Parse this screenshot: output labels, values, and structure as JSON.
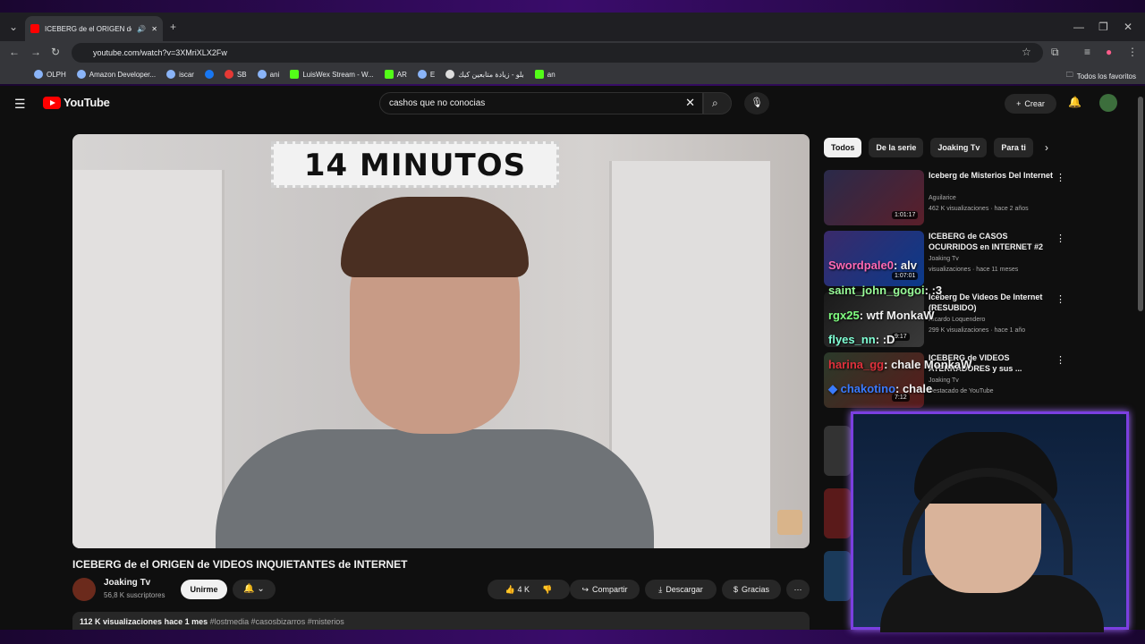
{
  "browser": {
    "tab_title": "ICEBERG de el ORIGEN de V",
    "url": "youtube.com/watch?v=3XMriXLX2Fw",
    "bookmarks": [
      "OLPH",
      "Amazon Developer...",
      "iscar",
      "",
      "SB",
      "ani",
      "LuisWex Stream - W...",
      "AR",
      "E",
      "بلو - زيادة متابعين كيك",
      "an"
    ],
    "all_bookmarks": "Todos los favoritos"
  },
  "youtube": {
    "logo": "YouTube",
    "search_value": "cashos que no conocias",
    "create_label": "Crear",
    "video_overlay_text": "14 MINUTOS",
    "video_title": "ICEBERG de el ORIGEN de VIDEOS INQUIETANTES de INTERNET",
    "channel_name": "Joaking Tv",
    "channel_subs": "56,8 K suscriptores",
    "join_label": "Unirme",
    "like_count": "4 K",
    "share_label": "Compartir",
    "download_label": "Descargar",
    "thanks_label": "Gracias",
    "views": "112 K visualizaciones",
    "age": "hace 1 mes",
    "tags": "#lostmedia #casosbizarros #misterios",
    "chips": [
      "Todos",
      "De la serie",
      "Joaking Tv",
      "Para ti"
    ],
    "recommendations": [
      {
        "title": "Iceberg de Misterios Del Internet",
        "channel": "Aguilarice",
        "meta": "462 K visualizaciones · hace 2 años",
        "duration": "1:01:17"
      },
      {
        "title": "ICEBERG de CASOS OCURRIDOS en INTERNET #2",
        "channel": "Joaking Tv",
        "meta": "visualizaciones · hace 11 meses",
        "duration": "1:07:01"
      },
      {
        "title": "Iceberg De Videos De Internet (RESUBIDO)",
        "channel": "Ricardo Loquendero",
        "meta": "299 K visualizaciones · hace 1 año",
        "duration": "9:17"
      },
      {
        "title": "ICEBERG de VIDEOS ATERRADORES y sus ...",
        "channel": "Joaking Tv",
        "meta": "Destacado de YouTube",
        "duration": "7:12"
      }
    ]
  },
  "chat": [
    {
      "user": "Swordpale0",
      "msg": ": alv",
      "color": "#ff69b4"
    },
    {
      "user": "saint_john_gogoi",
      "msg": ": :3",
      "color": "#98fb98"
    },
    {
      "user": "rgx25",
      "msg": ": wtf MonkaW",
      "color": "#7fff7f"
    },
    {
      "user": "flyes_nn",
      "msg": ": :D",
      "color": "#7fffd4"
    },
    {
      "user": "harina_gg",
      "msg": ": chale MonkaW",
      "color": "#e0313c"
    },
    {
      "user": "chakotino",
      "msg": ": chale",
      "color": "#3a7bff"
    }
  ]
}
